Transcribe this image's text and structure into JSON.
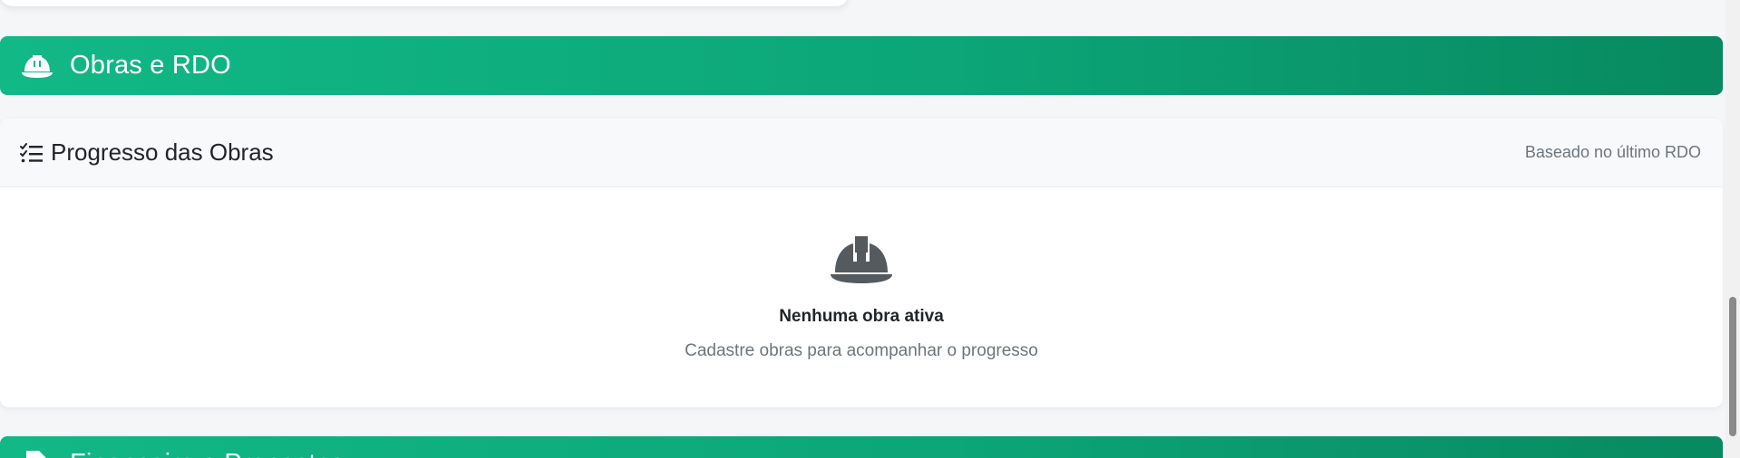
{
  "obras_section": {
    "icon": "hard-hat-icon",
    "title": "Obras e RDO"
  },
  "progress_card": {
    "icon": "list-check-icon",
    "title": "Progresso das Obras",
    "subtitle": "Baseado no último RDO",
    "empty_state": {
      "icon": "hard-hat-icon",
      "title": "Nenhuma obra ativa",
      "message": "Cadastre obras para acompanhar o progresso"
    }
  },
  "next_section": {
    "icon": "file-icon",
    "title": "Financeiro e Propostas"
  },
  "colors": {
    "header_gradient_start": "#12b886",
    "header_gradient_end": "#08895f",
    "empty_icon": "#555a5f",
    "muted_text": "#6c757d"
  }
}
